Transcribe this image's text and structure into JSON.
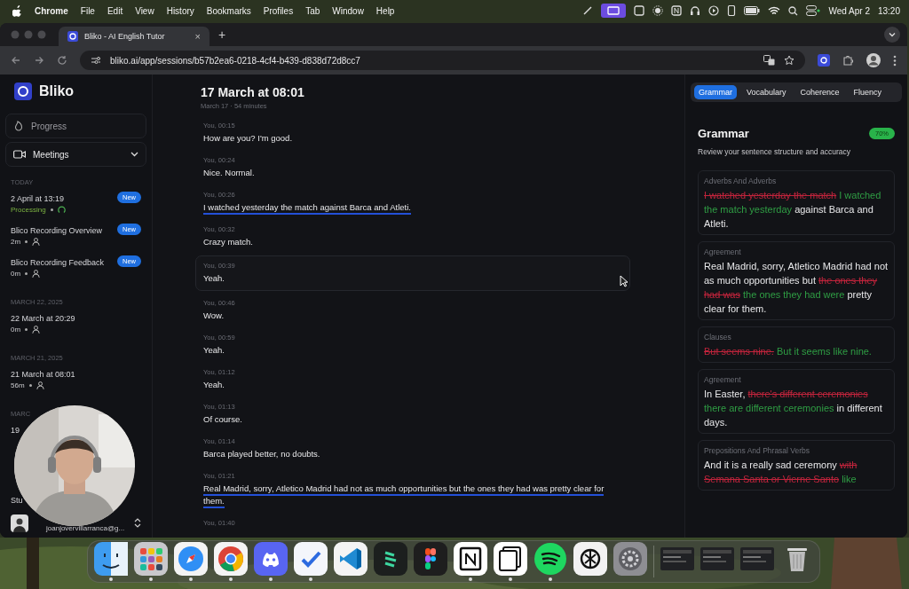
{
  "menu_bar": {
    "app": "Chrome",
    "items": [
      "File",
      "Edit",
      "View",
      "History",
      "Bookmarks",
      "Profiles",
      "Tab",
      "Window",
      "Help"
    ],
    "date": "Wed Apr 2",
    "time": "13:20"
  },
  "browser": {
    "tab_title": "Bliko - AI English Tutor",
    "tab_close": "×",
    "new_tab": "+",
    "url": "bliko.ai/app/sessions/b57b2ea6-0218-4cf4-b439-d838d72d8cc7"
  },
  "sidebar": {
    "logo": "Bliko",
    "nav": [
      {
        "label": "Progress",
        "kind": "progress"
      },
      {
        "label": "Meetings",
        "kind": "meetings"
      }
    ],
    "groups": [
      {
        "label": "TODAY",
        "items": [
          {
            "title": "2 April at 13:19",
            "kind": "processing",
            "meta": "Processing",
            "badge": "New"
          },
          {
            "title": "Blico Recording Overview",
            "kind": "duration",
            "meta": "2m",
            "badge": "New"
          },
          {
            "title": "Blico Recording Feedback",
            "kind": "duration",
            "meta": "0m",
            "badge": "New"
          }
        ]
      },
      {
        "label": "MARCH 22, 2025",
        "items": [
          {
            "title": "22 March at 20:29",
            "kind": "duration",
            "meta": "0m"
          }
        ]
      },
      {
        "label": "MARCH 21, 2025",
        "items": [
          {
            "title": "21 March at 08:01",
            "kind": "duration",
            "meta": "56m"
          }
        ]
      },
      {
        "label": "MARC",
        "items": [
          {
            "title": "19",
            "kind": "none"
          }
        ]
      }
    ],
    "footer_label": "Stu",
    "user_email": "joanjovervillarranca@g..."
  },
  "session": {
    "title": "17 March at 08:01",
    "subtitle": "March 17 · 54 minutes",
    "messages": [
      {
        "speaker": "You, 00:15",
        "text": "How are you? I'm good.",
        "flagged": false,
        "highlighted": false
      },
      {
        "speaker": "You, 00:24",
        "text": "Nice. Normal.",
        "flagged": false,
        "highlighted": false
      },
      {
        "speaker": "You, 00:26",
        "text": "I watched yesterday the match against Barca and Atleti.",
        "flagged": true,
        "highlighted": false
      },
      {
        "speaker": "You, 00:32",
        "text": "Crazy match.",
        "flagged": false,
        "highlighted": false
      },
      {
        "speaker": "You, 00:39",
        "text": "Yeah.",
        "flagged": false,
        "highlighted": true
      },
      {
        "speaker": "You, 00:46",
        "text": "Wow.",
        "flagged": false,
        "highlighted": false
      },
      {
        "speaker": "You, 00:59",
        "text": "Yeah.",
        "flagged": false,
        "highlighted": false
      },
      {
        "speaker": "You, 01:12",
        "text": "Yeah.",
        "flagged": false,
        "highlighted": false
      },
      {
        "speaker": "You, 01:13",
        "text": "Of course.",
        "flagged": false,
        "highlighted": false
      },
      {
        "speaker": "You, 01:14",
        "text": "Barca played better, no doubts.",
        "flagged": false,
        "highlighted": false
      },
      {
        "speaker": "You, 01:21",
        "text": "Real Madrid, sorry, Atletico Madrid had not as much opportunities but the ones they had was pretty clear for them.",
        "flagged": true,
        "highlighted": false
      },
      {
        "speaker": "You, 01:40",
        "highlighted": false
      }
    ]
  },
  "feedback": {
    "tabs": [
      {
        "label": "Grammar",
        "selected": true
      },
      {
        "label": "Vocabulary",
        "selected": false
      },
      {
        "label": "Coherence",
        "selected": false
      },
      {
        "label": "Fluency",
        "selected": false
      }
    ],
    "title": "Grammar",
    "score": "70%",
    "description": "Review your sentence structure and accuracy",
    "cards": [
      {
        "category": "Adverbs And Adverbs",
        "segments": [
          {
            "kind": "wrong",
            "text": "I watched yesterday the match"
          },
          {
            "kind": "fix",
            "text": "I watched the match yesterday"
          },
          {
            "kind": "plain",
            "text": "against Barca and Atleti."
          }
        ]
      },
      {
        "category": "Agreement",
        "segments": [
          {
            "kind": "plain",
            "text": "Real Madrid, sorry, Atletico Madrid had not as much opportunities but"
          },
          {
            "kind": "wrong",
            "text": "the ones they had was"
          },
          {
            "kind": "fix",
            "text": "the ones they had were"
          },
          {
            "kind": "plain",
            "text": "pretty clear for them."
          }
        ]
      },
      {
        "category": "Clauses",
        "segments": [
          {
            "kind": "wrong",
            "text": "But seems nine."
          },
          {
            "kind": "fix",
            "text": "But it seems like nine."
          }
        ]
      },
      {
        "category": "Agreement",
        "segments": [
          {
            "kind": "plain",
            "text": "In Easter,"
          },
          {
            "kind": "wrong",
            "text": "there's different ceremonies"
          },
          {
            "kind": "fix",
            "text": "there are different ceremonies"
          },
          {
            "kind": "plain",
            "text": "in different days."
          }
        ]
      },
      {
        "category": "Prepositions And Phrasal Verbs",
        "segments": [
          {
            "kind": "plain",
            "text": "And it is a really sad ceremony"
          },
          {
            "kind": "wrong",
            "text": "with Semana Santa or Vierne Santo"
          },
          {
            "kind": "fix",
            "text": "like"
          }
        ]
      }
    ]
  },
  "dock": [
    {
      "kind": "finder",
      "running": true
    },
    {
      "kind": "launchpad",
      "running": true
    },
    {
      "kind": "safari",
      "running": true
    },
    {
      "kind": "chrome",
      "running": true
    },
    {
      "kind": "discord",
      "running": true
    },
    {
      "kind": "tasks",
      "running": true
    },
    {
      "kind": "vscode",
      "running": false
    },
    {
      "kind": "stripes",
      "running": false
    },
    {
      "kind": "figma",
      "running": false
    },
    {
      "kind": "notion",
      "running": true
    },
    {
      "kind": "pages",
      "running": true
    },
    {
      "kind": "spotify",
      "running": true
    },
    {
      "kind": "knot",
      "running": false
    },
    {
      "kind": "settings",
      "running": false
    },
    {
      "kind": "separator"
    },
    {
      "kind": "window",
      "running": false
    },
    {
      "kind": "window",
      "running": false
    },
    {
      "kind": "window",
      "running": false
    },
    {
      "kind": "trash",
      "running": false
    }
  ]
}
